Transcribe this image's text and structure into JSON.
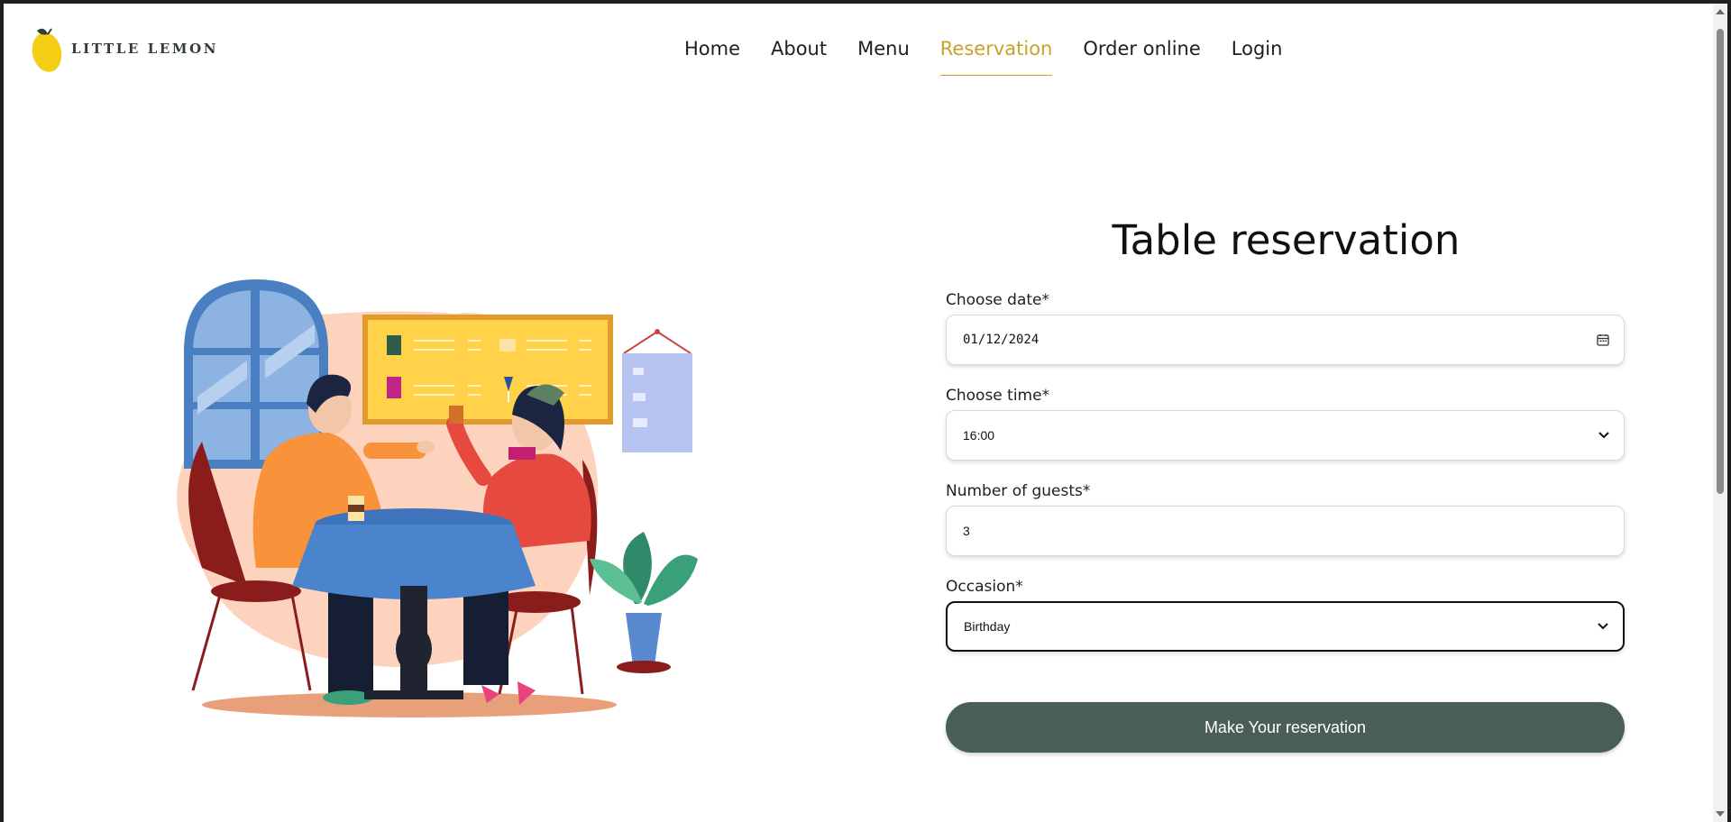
{
  "header": {
    "logo_text": "LITTLE LEMON",
    "nav": [
      {
        "label": "Home",
        "active": false
      },
      {
        "label": "About",
        "active": false
      },
      {
        "label": "Menu",
        "active": false
      },
      {
        "label": "Reservation",
        "active": true
      },
      {
        "label": "Order online",
        "active": false
      },
      {
        "label": "Login",
        "active": false
      }
    ]
  },
  "form": {
    "title": "Table reservation",
    "date": {
      "label": "Choose date*",
      "value": "01/12/2024"
    },
    "time": {
      "label": "Choose time*",
      "value": "16:00"
    },
    "guests": {
      "label": "Number of guests*",
      "value": "3"
    },
    "occasion": {
      "label": "Occasion*",
      "value": "Birthday"
    },
    "submit_label": "Make Your reservation"
  },
  "colors": {
    "accent": "#c9a227",
    "primary": "#495e57",
    "lemon": "#f4ce14"
  },
  "icons": {
    "date": "calendar-icon",
    "select": "chevron-down-icon"
  }
}
